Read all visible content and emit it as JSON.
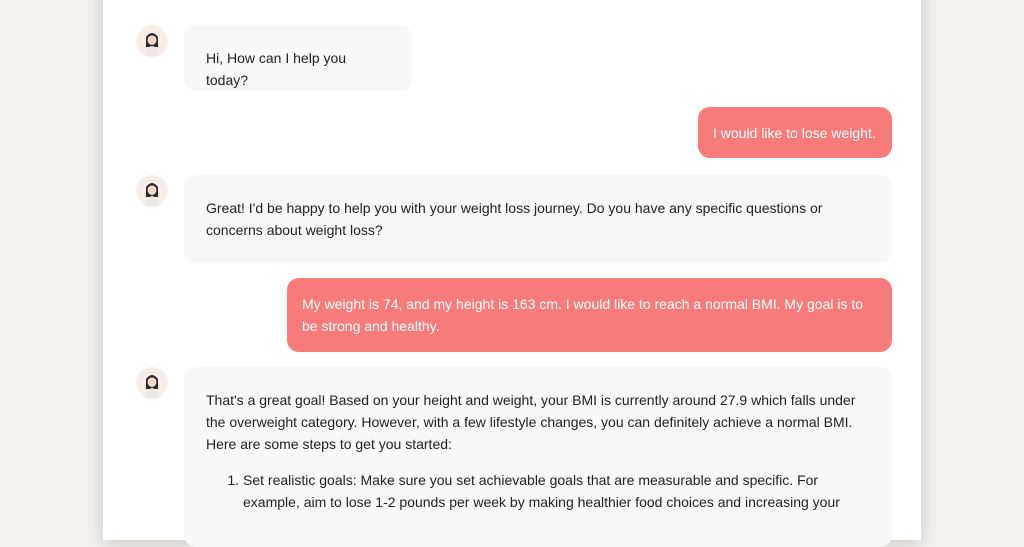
{
  "colors": {
    "page_background": "#f5f1ee",
    "panel_background": "#ffffff",
    "bot_bubble": "#f8f8f8",
    "user_bubble": "#f87b7b",
    "user_text": "#ffffff",
    "bot_text": "#222222"
  },
  "conversation": {
    "messages": [
      {
        "sender": "assistant",
        "avatar": "woman-avatar-icon",
        "text": "Hi, How can I help you today?"
      },
      {
        "sender": "user",
        "text": "I would like to lose weight."
      },
      {
        "sender": "assistant",
        "avatar": "woman-avatar-icon",
        "text": "Great! I'd be happy to help you with your weight loss journey. Do you have any specific questions or concerns about weight loss?"
      },
      {
        "sender": "user",
        "text": "My weight is 74, and my height is 163 cm. I would like to reach a normal BMI. My goal is to be strong and healthy."
      },
      {
        "sender": "assistant",
        "avatar": "woman-avatar-icon",
        "text": "That's a great goal! Based on your height and weight, your BMI is currently around 27.9 which falls under the overweight category. However, with a few lifestyle changes, you can definitely achieve a normal BMI. Here are some steps to get you started:",
        "steps": [
          "Set realistic goals: Make sure you set achievable goals that are measurable and specific. For example, aim to lose 1-2 pounds per week by making healthier food choices and increasing your"
        ]
      }
    ]
  }
}
